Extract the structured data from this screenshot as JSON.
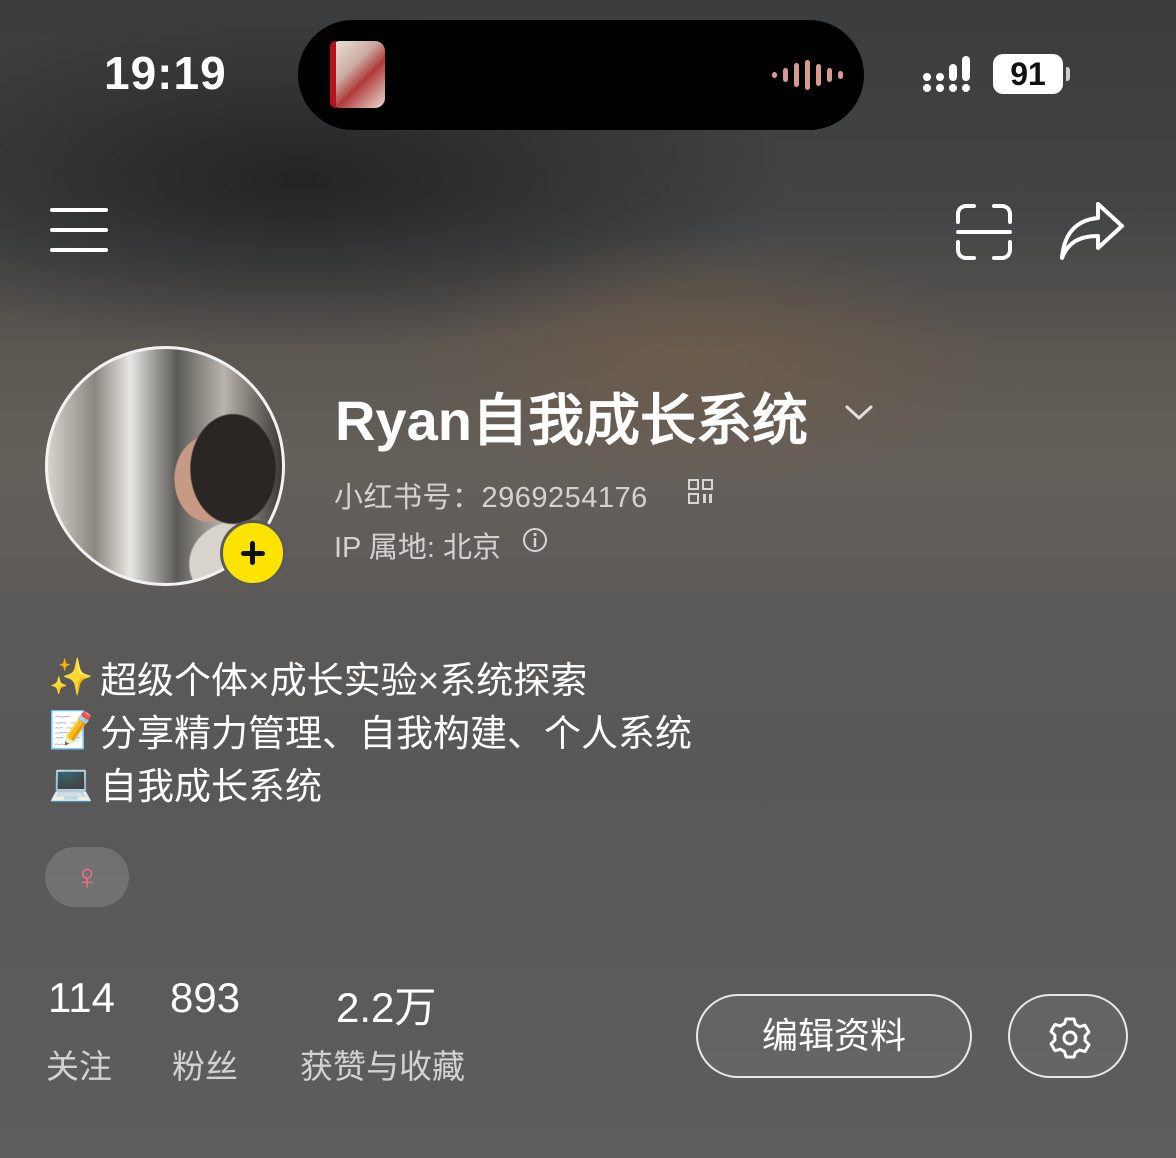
{
  "status_bar": {
    "time": "19:19",
    "battery": "91"
  },
  "profile": {
    "name": "Ryan自我成长系统",
    "red_id": "小红书号：2969254176",
    "ip_location": "IP 属地: 北京",
    "bio": [
      {
        "emoji": "✨",
        "text": "超级个体×成长实验×系统探索"
      },
      {
        "emoji": "📝",
        "text": "分享精力管理、自我构建、个人系统"
      },
      {
        "emoji": "💻",
        "text": "自我成长系统"
      }
    ],
    "gender_symbol": "♀"
  },
  "stats": [
    {
      "value": "114",
      "label": "关注"
    },
    {
      "value": "893",
      "label": "粉丝"
    },
    {
      "value": "2.2万",
      "label": "获赞与收藏"
    }
  ],
  "actions": {
    "edit_profile": "编辑资料"
  },
  "colors": {
    "gender_accent": "#ff6b8a",
    "avatar_add_badge": "#fde400"
  }
}
